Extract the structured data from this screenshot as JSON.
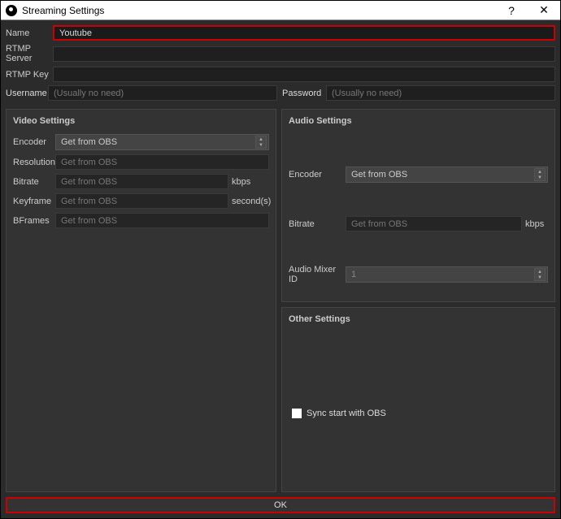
{
  "window": {
    "title": "Streaming Settings"
  },
  "fields": {
    "name": {
      "label": "Name",
      "value": "Youtube"
    },
    "rtmp_server": {
      "label": "RTMP Server",
      "value": ""
    },
    "rtmp_key": {
      "label": "RTMP Key",
      "value": ""
    },
    "username": {
      "label": "Username",
      "placeholder": "(Usually no need)",
      "value": ""
    },
    "password": {
      "label": "Password",
      "placeholder": "(Usually no need)",
      "value": ""
    }
  },
  "video": {
    "title": "Video Settings",
    "encoder": {
      "label": "Encoder",
      "value": "Get from OBS"
    },
    "resolution": {
      "label": "Resolution",
      "placeholder": "Get from OBS",
      "value": ""
    },
    "bitrate": {
      "label": "Bitrate",
      "placeholder": "Get from OBS",
      "value": "",
      "suffix": "kbps"
    },
    "keyframe": {
      "label": "Keyframe",
      "placeholder": "Get from OBS",
      "value": "",
      "suffix": "second(s)"
    },
    "bframes": {
      "label": "BFrames",
      "placeholder": "Get from OBS",
      "value": ""
    }
  },
  "audio": {
    "title": "Audio Settings",
    "encoder": {
      "label": "Encoder",
      "value": "Get from OBS"
    },
    "bitrate": {
      "label": "Bitrate",
      "placeholder": "Get from OBS",
      "value": "",
      "suffix": "kbps"
    },
    "mixer": {
      "label": "Audio Mixer ID",
      "value": "1"
    }
  },
  "other": {
    "title": "Other Settings",
    "sync": {
      "label": "Sync start with OBS",
      "checked": false
    }
  },
  "buttons": {
    "ok": "OK"
  }
}
